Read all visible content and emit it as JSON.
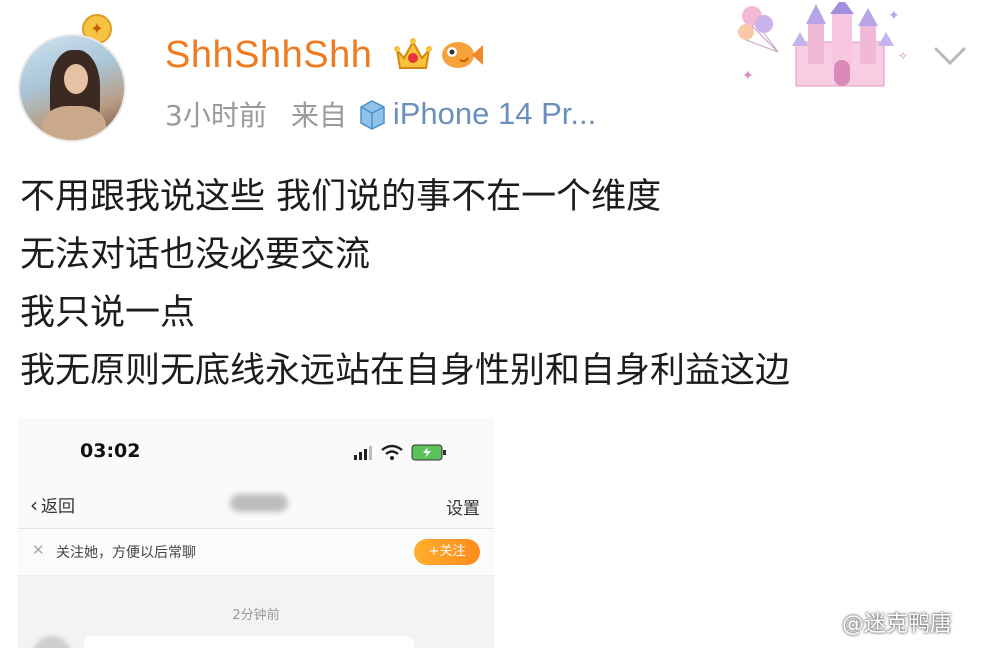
{
  "post": {
    "username": "ShhShhShh",
    "time": "3小时前",
    "from_label": "来自",
    "device": "iPhone 14 Pr...",
    "lines": [
      "不用跟我说这些 我们说的事不在一个维度",
      "无法对话也没必要交流",
      "我只说一点",
      "我无原则无底线永远站在自身性别和自身利益这边"
    ]
  },
  "icons": {
    "avatar_badge": "gold-medal-icon",
    "crown": "crown-icon",
    "fish": "fish-icon",
    "device": "phone-icon",
    "menu": "chevron-down-icon",
    "decoration": "castle-balloons-sticker"
  },
  "screenshot": {
    "clock": "03:02",
    "back_label": "返回",
    "settings_label": "设置",
    "follow_tip": "关注她，方便以后常聊",
    "follow_button": "+关注",
    "chat_time": "2分钟前"
  },
  "watermark": {
    "text": "@迷克鸭唐"
  },
  "colors": {
    "username": "#f07a1f",
    "device": "#6a8fbd",
    "meta": "#9a9a9a",
    "follow_button": "#ff8a1e"
  }
}
